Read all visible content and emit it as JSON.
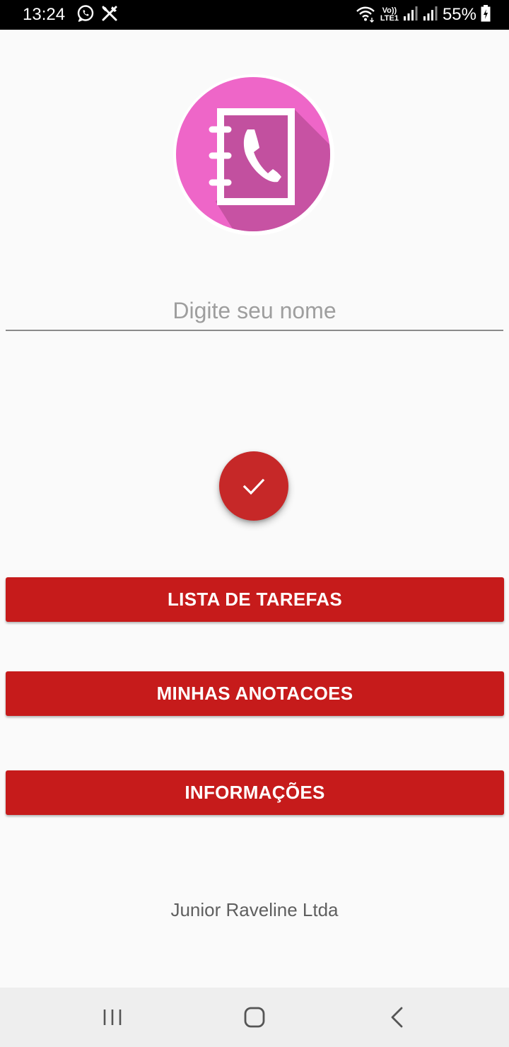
{
  "status_bar": {
    "time": "13:24",
    "battery_percent": "55%",
    "left_icons": [
      "whatsapp-icon",
      "utensils-icon"
    ],
    "right_icons": [
      "wifi-icon",
      "volte-icon",
      "signal-icon",
      "signal-icon",
      "battery-icon"
    ],
    "volte_label_top": "Vo))",
    "volte_label_bottom": "LTE1"
  },
  "logo": {
    "icon": "contact-book-phone-icon",
    "colors": {
      "circle": "#ee66c8",
      "book_shadow": "#c2509f",
      "ring": "#ffffff"
    }
  },
  "name_input": {
    "placeholder": "Digite seu nome",
    "value": ""
  },
  "fab": {
    "icon": "check-icon",
    "color": "#c62828"
  },
  "buttons": {
    "tasks_label": "LISTA DE TAREFAS",
    "notes_label": "MINHAS ANOTACOES",
    "info_label": "INFORMAÇÕES",
    "color": "#c61b1b"
  },
  "footer": {
    "company": "Junior Raveline Ltda"
  },
  "nav_bar": {
    "icons": [
      "recents-icon",
      "home-icon",
      "back-icon"
    ]
  }
}
